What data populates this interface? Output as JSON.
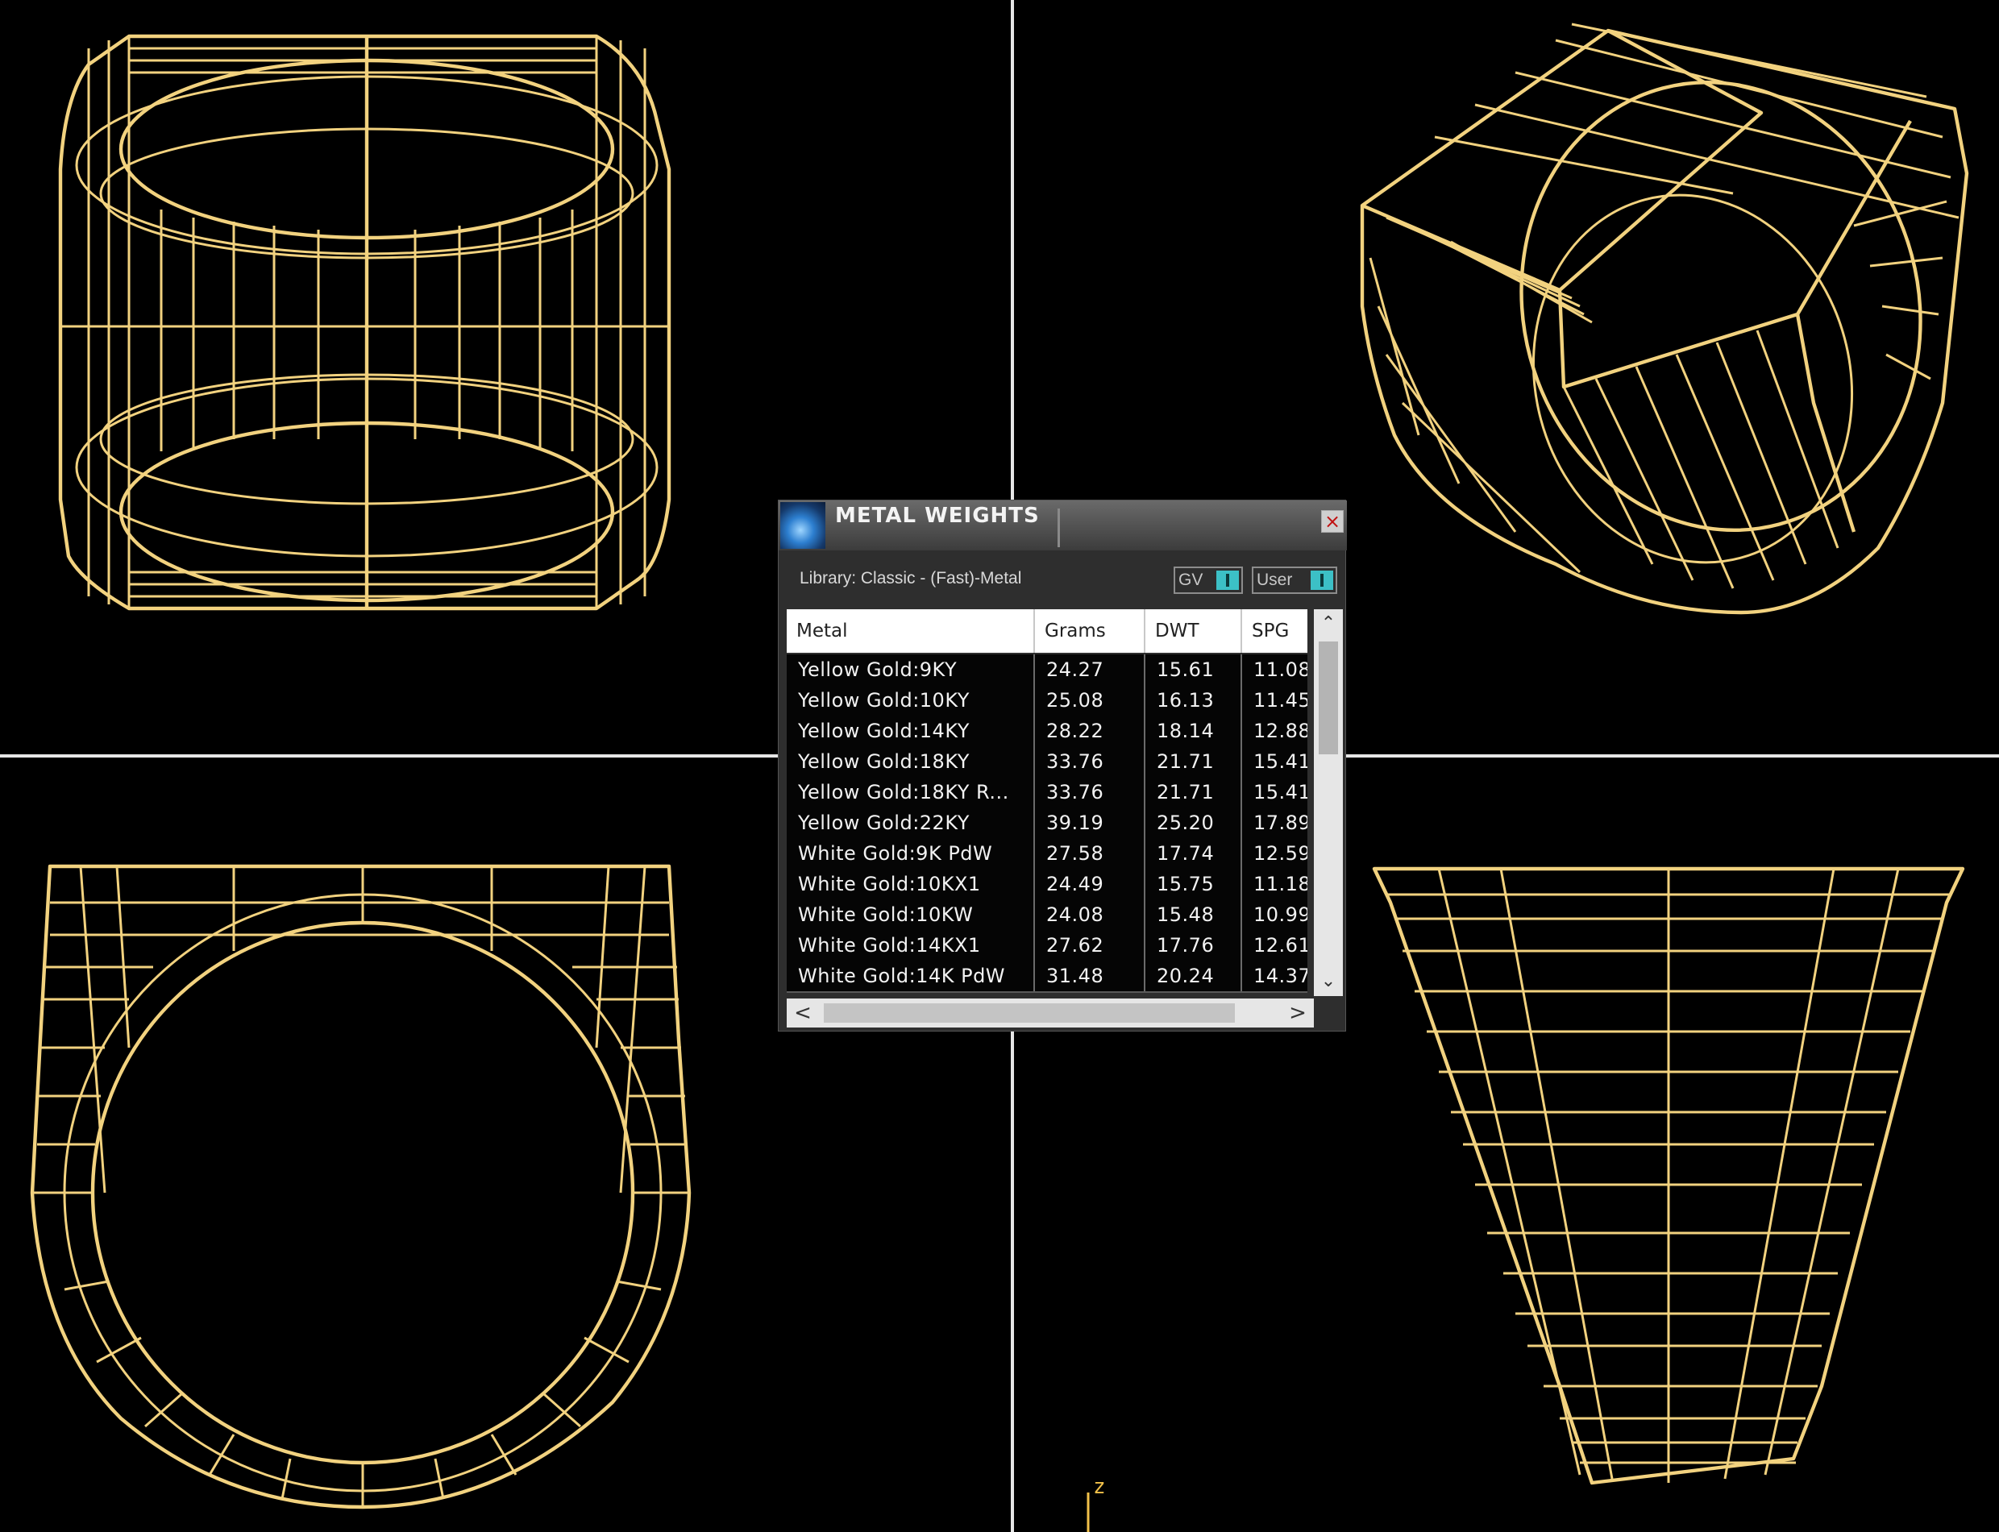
{
  "dialog": {
    "title": "METAL WEIGHTS",
    "close_glyph": "×",
    "library_label": "Library: Classic - (Fast)-Metal",
    "toggles": [
      {
        "label": "GV",
        "state": "on"
      },
      {
        "label": "User",
        "state": "on"
      }
    ],
    "columns": [
      "Metal",
      "Grams",
      "DWT",
      "SPG"
    ],
    "rows": [
      {
        "metal": "Yellow Gold:9KY",
        "grams": "24.27",
        "dwt": "15.61",
        "spg": "11.08"
      },
      {
        "metal": "Yellow Gold:10KY",
        "grams": "25.08",
        "dwt": "16.13",
        "spg": "11.45"
      },
      {
        "metal": "Yellow Gold:14KY",
        "grams": "28.22",
        "dwt": "18.14",
        "spg": "12.88"
      },
      {
        "metal": "Yellow Gold:18KY",
        "grams": "33.76",
        "dwt": "21.71",
        "spg": "15.41"
      },
      {
        "metal": "Yellow Gold:18KY R...",
        "grams": "33.76",
        "dwt": "21.71",
        "spg": "15.41"
      },
      {
        "metal": "Yellow Gold:22KY",
        "grams": "39.19",
        "dwt": "25.20",
        "spg": "17.89"
      },
      {
        "metal": "White Gold:9K PdW",
        "grams": "27.58",
        "dwt": "17.74",
        "spg": "12.59"
      },
      {
        "metal": "White Gold:10KX1",
        "grams": "24.49",
        "dwt": "15.75",
        "spg": "11.18"
      },
      {
        "metal": "White Gold:10KW",
        "grams": "24.08",
        "dwt": "15.48",
        "spg": "10.99"
      },
      {
        "metal": "White Gold:14KX1",
        "grams": "27.62",
        "dwt": "17.76",
        "spg": "12.61"
      },
      {
        "metal": "White Gold:14K PdW",
        "grams": "31.48",
        "dwt": "20.24",
        "spg": "14.37"
      }
    ],
    "scroll": {
      "up": "⌃",
      "down": "⌄",
      "left": "<",
      "right": ">"
    }
  },
  "viewports": {
    "axis_label": "z",
    "wire_color": "#f2d27f"
  }
}
